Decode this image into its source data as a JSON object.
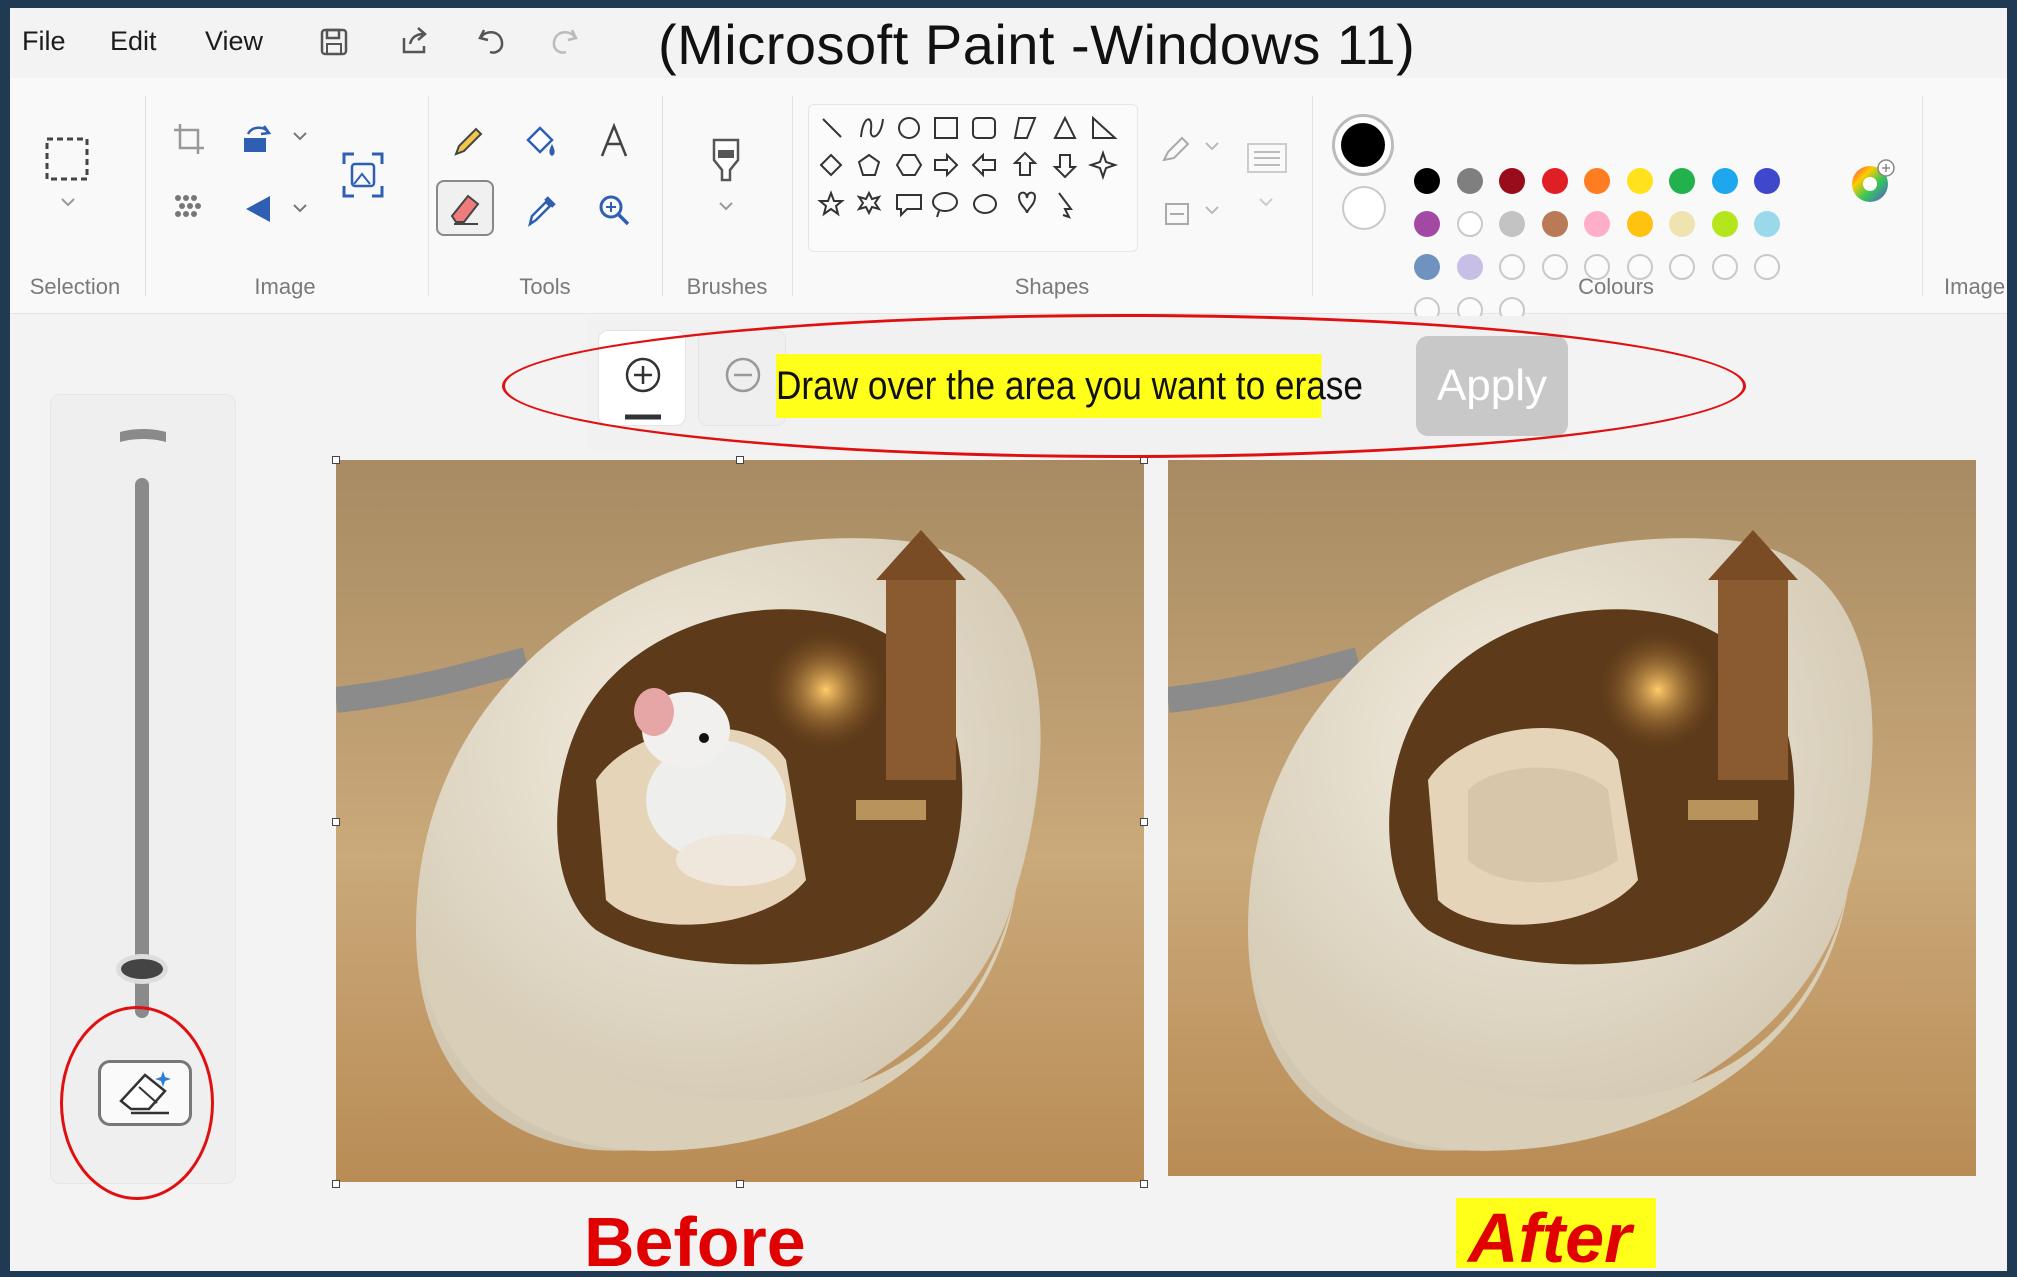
{
  "menu": {
    "file": "File",
    "edit": "Edit",
    "view": "View"
  },
  "caption": "(Microsoft Paint -Windows 11)",
  "ribbon": {
    "groups": {
      "selection": "Selection",
      "image": "Image",
      "tools": "Tools",
      "brushes": "Brushes",
      "shapes": "Shapes",
      "colours": "Colours",
      "image2": "Image"
    }
  },
  "colours": {
    "primary": "#000000",
    "secondary": "#ffffff",
    "row1": [
      "#000000",
      "#7f7f7f",
      "#990c1b",
      "#e01e25",
      "#ff7d22",
      "#ffe21b",
      "#22b14c",
      "#1ea6ee",
      "#3f48cc"
    ],
    "row2": [
      "#a349a4",
      "#ffffff",
      "#c3c3c3",
      "#b97a57",
      "#ffaec9",
      "#ffc20e",
      "#efe4b0",
      "#b5e61d",
      "#99d9ea"
    ],
    "row3": [
      "#7092be",
      "#c8bfe7",
      "",
      "",
      "",
      "",
      "",
      "",
      ""
    ],
    "row4": [
      "",
      "",
      ""
    ]
  },
  "erase_toolbar": {
    "instruction": "Draw over the area you want to erase",
    "apply": "Apply"
  },
  "labels": {
    "before": "Before",
    "after": "After"
  }
}
